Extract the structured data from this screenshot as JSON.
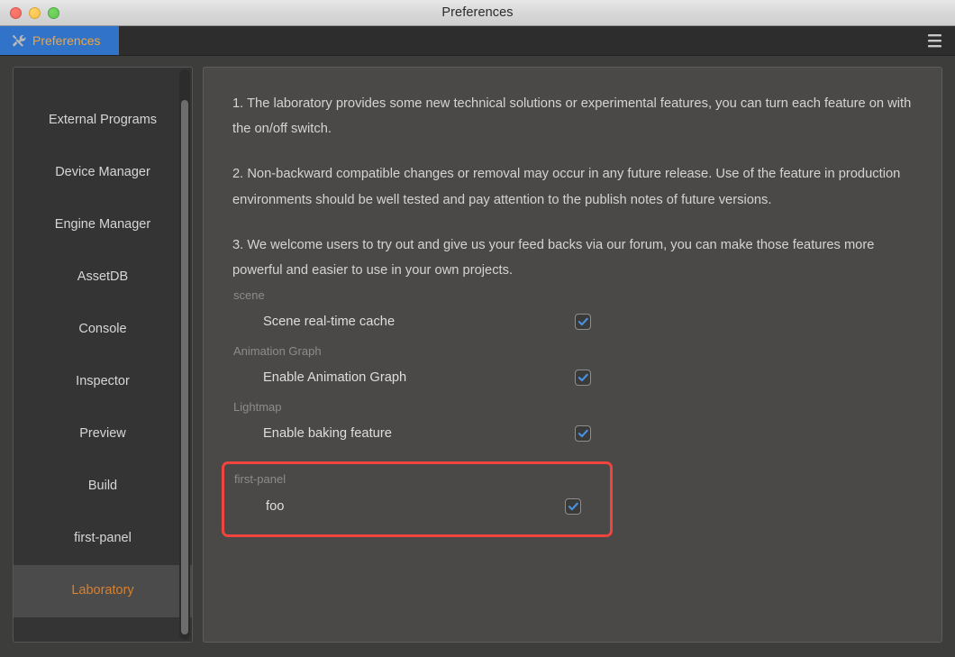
{
  "window": {
    "title": "Preferences",
    "traffic_lights": [
      "close-button",
      "minimize-button",
      "maximize-button"
    ]
  },
  "tabbar": {
    "tab_label": "Preferences",
    "tab_icon": "wrench-tools-icon",
    "tab_background": "#3173c8",
    "tab_text_color": "#f0a63c",
    "menu_icon": "hamburger-menu-icon"
  },
  "sidebar": {
    "items": [
      {
        "label": "External Programs",
        "selected": false
      },
      {
        "label": "Device Manager",
        "selected": false
      },
      {
        "label": "Engine Manager",
        "selected": false
      },
      {
        "label": "AssetDB",
        "selected": false
      },
      {
        "label": "Console",
        "selected": false
      },
      {
        "label": "Inspector",
        "selected": false
      },
      {
        "label": "Preview",
        "selected": false
      },
      {
        "label": "Build",
        "selected": false
      },
      {
        "label": "first-panel",
        "selected": false
      },
      {
        "label": "Laboratory",
        "selected": true
      }
    ],
    "selected_color": "#d8812e"
  },
  "content": {
    "paragraphs": [
      "1. The laboratory provides some new technical solutions or experimental features, you can turn each feature on with the on/off switch.",
      "2. Non-backward compatible changes or removal may occur in any future release. Use of the feature in production environments should be well tested and pay attention to the publish notes of future versions.",
      "3. We welcome users to try out and give us your feed backs via our forum, you can make those features more powerful and easier to use in your own projects."
    ],
    "groups": [
      {
        "label": "scene",
        "highlighted": false,
        "settings": [
          {
            "label": "Scene real-time cache",
            "checked": true
          }
        ]
      },
      {
        "label": "Animation Graph",
        "highlighted": false,
        "settings": [
          {
            "label": "Enable Animation Graph",
            "checked": true
          }
        ]
      },
      {
        "label": "Lightmap",
        "highlighted": false,
        "settings": [
          {
            "label": "Enable baking feature",
            "checked": true
          }
        ]
      },
      {
        "label": "first-panel",
        "highlighted": true,
        "highlight_color": "#f0453f",
        "settings": [
          {
            "label": "foo",
            "checked": true
          }
        ]
      }
    ],
    "checkbox_check_color": "#4a90e2"
  }
}
